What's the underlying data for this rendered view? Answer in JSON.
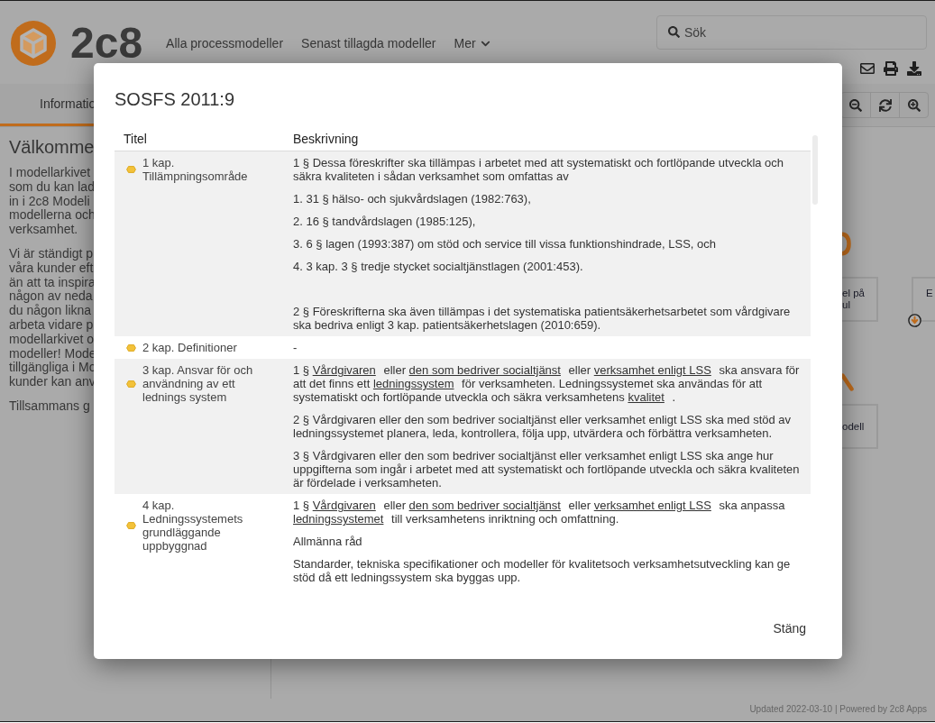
{
  "header": {
    "logo_text": "2c8",
    "nav": [
      {
        "label": "Alla processmodeller",
        "kind": "link"
      },
      {
        "label": "Senast tillagda modeller",
        "kind": "link"
      },
      {
        "label": "Mer",
        "kind": "menu"
      }
    ],
    "search": {
      "placeholder": "Sök"
    }
  },
  "toolbar": {
    "tabs": [
      {
        "label": "Informatio",
        "selected": true
      }
    ]
  },
  "welcome": {
    "heading": "Välkomme",
    "paragraphs": [
      {
        "lines": [
          "I modellarkivet",
          "som du kan lad",
          "in i 2c8 Modeli",
          "modellerna och",
          "verksamhet."
        ]
      },
      {
        "lines": [
          "Vi är ständigt p",
          "våra kunder eft",
          "än att ta inspira",
          "någon av neda",
          "du någon likna",
          "arbeta vidare p",
          "modellarkivet o",
          "modeller! Mode",
          "tillgängliga i Mo",
          "kunder kan anv"
        ]
      },
      {
        "lines": [
          "Tillsammans g"
        ]
      }
    ]
  },
  "diagram": {
    "nodes": [
      {
        "lines": [
          "el på",
          "ul"
        ]
      },
      {
        "lines": [
          "E"
        ]
      },
      {
        "lines": [
          "odell"
        ]
      }
    ]
  },
  "footer": {
    "text": "Updated 2022-03-10 | Powered by 2c8 Apps"
  },
  "modal": {
    "title": "SOSFS 2011:9",
    "columns": [
      "Titel",
      "Beskrivning"
    ],
    "rows": [
      {
        "title": "1 kap. Tillämpningsområde",
        "paragraphs": [
          {
            "text": "1 § Dessa föreskrifter ska tillämpas i arbetet med att systematiskt och fortlöpande utveckla och säkra kvaliteten i sådan verksamhet som omfattas av"
          },
          {
            "text": "1. 31 § hälso- och sjukvårdslagen (1982:763),"
          },
          {
            "text": "2. 16 § tandvårdslagen (1985:125),"
          },
          {
            "text": "3. 6 § lagen (1993:387) om stöd och service till vissa funktionshindrade, LSS, och"
          },
          {
            "text": "4. 3 kap. 3 § tredje stycket socialtjänstlagen (2001:453)."
          },
          {
            "text": "2 § Föreskrifterna ska även tillämpas i det systematiska patientsäkerhetsarbetet som vårdgivare ska bedriva enligt 3 kap. patientsäkerhetslagen (2010:659).",
            "gap_before": true
          }
        ]
      },
      {
        "title": "2 kap. Definitioner",
        "paragraphs": [
          {
            "text": "-"
          }
        ]
      },
      {
        "title": "3 kap. Ansvar för och användning av ett lednings system",
        "paragraphs": [
          {
            "parts": [
              {
                "kind": "text",
                "text": "1 § "
              },
              {
                "kind": "link",
                "text": "Vårdgivaren"
              },
              {
                "kind": "text",
                "text": " eller "
              },
              {
                "kind": "link",
                "text": "den som bedriver socialtjänst"
              },
              {
                "kind": "text",
                "text": " eller "
              },
              {
                "kind": "link",
                "text": "verksamhet enligt LSS"
              },
              {
                "kind": "text",
                "text": " ska ansvara för att det finns ett "
              },
              {
                "kind": "link",
                "text": "ledningssystem"
              },
              {
                "kind": "text",
                "text": " för verksamheten. Ledningssystemet ska användas för att systematiskt och fortlöpande utveckla och säkra verksamhetens "
              },
              {
                "kind": "link",
                "text": "kvalitet"
              },
              {
                "kind": "text",
                "text": " ."
              }
            ]
          },
          {
            "text": "2 § Vårdgivaren eller den som bedriver socialtjänst eller verksamhet enligt LSS ska med stöd av ledningssystemet planera, leda, kontrollera, följa upp, utvärdera och förbättra verksamheten."
          },
          {
            "text": "3 § Vårdgivaren eller den som bedriver socialtjänst eller verksamhet enligt LSS ska ange hur uppgifterna som ingår i arbetet med att systematiskt och fortlöpande utveckla och säkra kvaliteten är fördelade i verksamheten."
          }
        ]
      },
      {
        "title": "4 kap. Ledningssystemets grundläggande uppbyggnad",
        "paragraphs": [
          {
            "parts": [
              {
                "kind": "text",
                "text": "1 § "
              },
              {
                "kind": "link",
                "text": "Vårdgivaren"
              },
              {
                "kind": "text",
                "text": " eller "
              },
              {
                "kind": "link",
                "text": "den som bedriver socialtjänst"
              },
              {
                "kind": "text",
                "text": " eller "
              },
              {
                "kind": "link",
                "text": "verksamhet enligt LSS"
              },
              {
                "kind": "text",
                "text": " ska anpassa "
              },
              {
                "kind": "link",
                "text": "ledningssystemet"
              },
              {
                "kind": "text",
                "text": " till verksamhetens inriktning och omfattning."
              }
            ]
          },
          {
            "text": "Allmänna råd"
          },
          {
            "text": "Standarder, tekniska specifikationer och modeller för kvalitetsoch verksamhetsutveckling kan ge stöd då ett ledningssystem ska byggas upp."
          }
        ]
      }
    ],
    "close_label": "Stäng"
  }
}
